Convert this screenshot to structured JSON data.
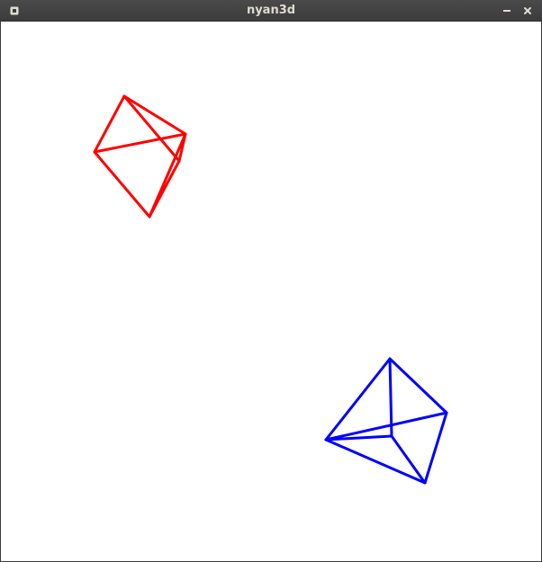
{
  "window": {
    "title": "nyan3d"
  },
  "icons": {
    "menu": "window-menu-icon",
    "minimize": "minimize-icon",
    "close": "close-icon"
  },
  "scene": {
    "background": "#ffffff",
    "shapes": [
      {
        "name": "red-tetrahedron",
        "color": "#ff0000"
      },
      {
        "name": "blue-tetrahedron",
        "color": "#0000ff"
      }
    ]
  }
}
